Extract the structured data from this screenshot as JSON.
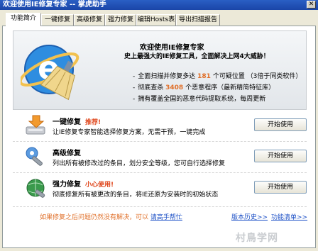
{
  "window": {
    "title": "欢迎使用IE修复专家  -- 掌虎助手",
    "close_icon": "close-icon"
  },
  "tabs": [
    {
      "label": "功能简介",
      "active": true
    },
    {
      "label": "一键修复",
      "active": false
    },
    {
      "label": "高级修复",
      "active": false
    },
    {
      "label": "强力修复",
      "active": false
    },
    {
      "label": "编辑Hosts表",
      "active": false
    },
    {
      "label": "导出扫描报告",
      "active": false
    }
  ],
  "banner": {
    "title": "欢迎使用IE修复专家",
    "subtitle": "史上最强大的IE修复工具，全面解决上网4大威胁！",
    "line1": {
      "prefix": "全面扫描并修复多达",
      "value": "181",
      "suffix": "个可疑位置 （3倍于同类软件）"
    },
    "line2": {
      "prefix": "彻底查杀",
      "value": "3408",
      "suffix": "个恶意程序（最新精简特征库）"
    },
    "line3": "拥有覆盖全国的恶意代码提取系统，每周更新",
    "bullet": "-"
  },
  "options": [
    {
      "title": "一键修复",
      "badge": "推荐!",
      "desc": "让IE修复专家智能选择修复方案，无需干预，一键完成",
      "button": "开始使用"
    },
    {
      "title": "高级修复",
      "badge": "",
      "desc": "列出所有被修改过的条目，划分安全等级，您可自行选择修复",
      "button": "开始使用"
    },
    {
      "title": "强力修复",
      "badge": "小心使用!",
      "desc": "彻底修复所有被更改的条目，将IE还原为安装时的初始状态",
      "button": "开始使用"
    }
  ],
  "footer": {
    "note": "如果修复之后问题仍然没有解决，可以",
    "help_link": "请高手帮忙",
    "version_link": "版本历史>>",
    "list_link": "功能清单>>"
  },
  "watermark": "村鳥学网",
  "colors": {
    "accent": "#e0702a",
    "link": "#1b4fc6",
    "title_bar": "#1a45a8"
  }
}
